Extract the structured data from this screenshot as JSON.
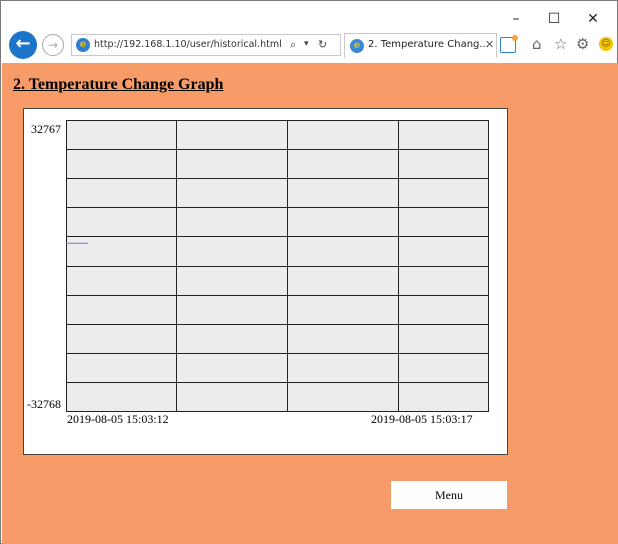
{
  "browser": {
    "window_controls": {
      "minimize": "–",
      "maximize": "☐",
      "close": "✕"
    },
    "address_bar": {
      "url": "http://192.168.1.10/user/historical.html"
    },
    "tab": {
      "title": "2. Temperature Chang...",
      "close": "✕"
    }
  },
  "page": {
    "title": "2. Temperature Change Graph",
    "menu_button": "Menu"
  },
  "chart_data": {
    "type": "line",
    "title": "",
    "ylim": [
      -32768,
      32767
    ],
    "y_tick_labels": [
      "32767",
      "-32768"
    ],
    "x_tick_labels": [
      "2019-08-05 15:03:12",
      "2019-08-05 15:03:17"
    ],
    "grid": true,
    "series": [
      {
        "values": [
          5000,
          5000
        ],
        "color": "#8a7fd6"
      }
    ],
    "colors": {
      "plot_background": "#ececec",
      "grid": "#222222"
    }
  }
}
